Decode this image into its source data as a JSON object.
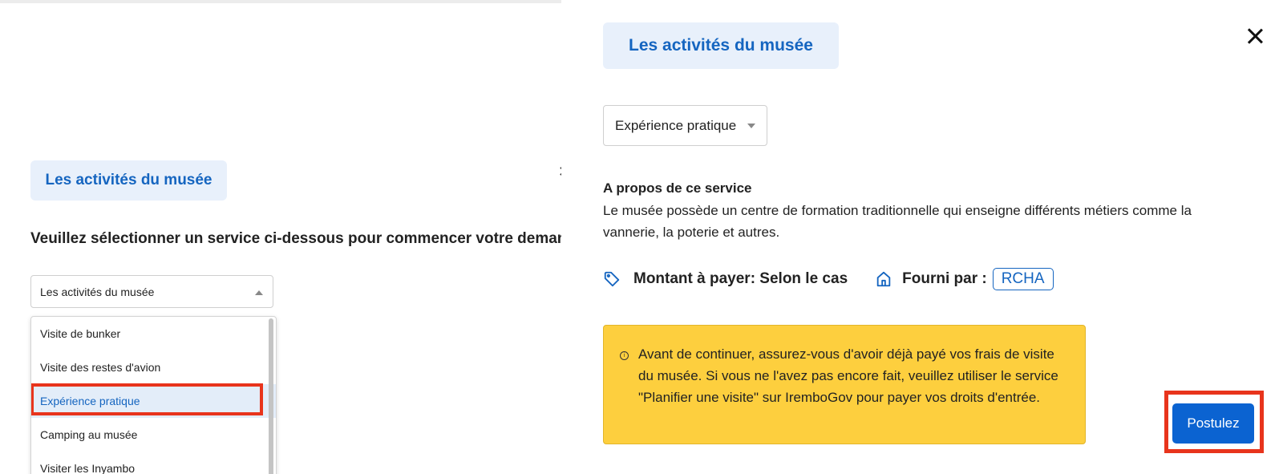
{
  "left": {
    "title": "Les activités du musée",
    "instruction": "Veuillez sélectionner un service ci-dessous pour commencer votre demande",
    "select_value": "Les activités du musée",
    "close_icon": "close-icon",
    "dropdown": [
      {
        "label": "Visite de bunker"
      },
      {
        "label": "Visite des restes d'avion"
      },
      {
        "label": "Expérience pratique",
        "selected": true
      },
      {
        "label": "Camping au musée"
      },
      {
        "label": "Visiter les Inyambo"
      }
    ]
  },
  "right": {
    "title": "Les activités du musée",
    "select_value": "Expérience pratique",
    "about_heading": "A propos de ce service",
    "about_text": "Le musée possède un centre de formation traditionnelle qui enseigne différents métiers comme la vannerie, la poterie et autres.",
    "amount_label": "Montant à payer: Selon le cas",
    "provider_label": "Fourni par :",
    "provider_value": "RCHA",
    "warning_icon": "i",
    "warning_text": "Avant de continuer, assurez-vous d'avoir déjà payé vos frais de visite du musée. Si vous ne l'avez pas encore fait, veuillez utiliser le service \"Planifier une visite\" sur IremboGov pour payer vos droits d'entrée.",
    "apply_label": "Postulez"
  },
  "colors": {
    "accent": "#1565c0",
    "button": "#0b63d1",
    "warning": "#fdcf3e",
    "highlight": "#e8341c"
  }
}
